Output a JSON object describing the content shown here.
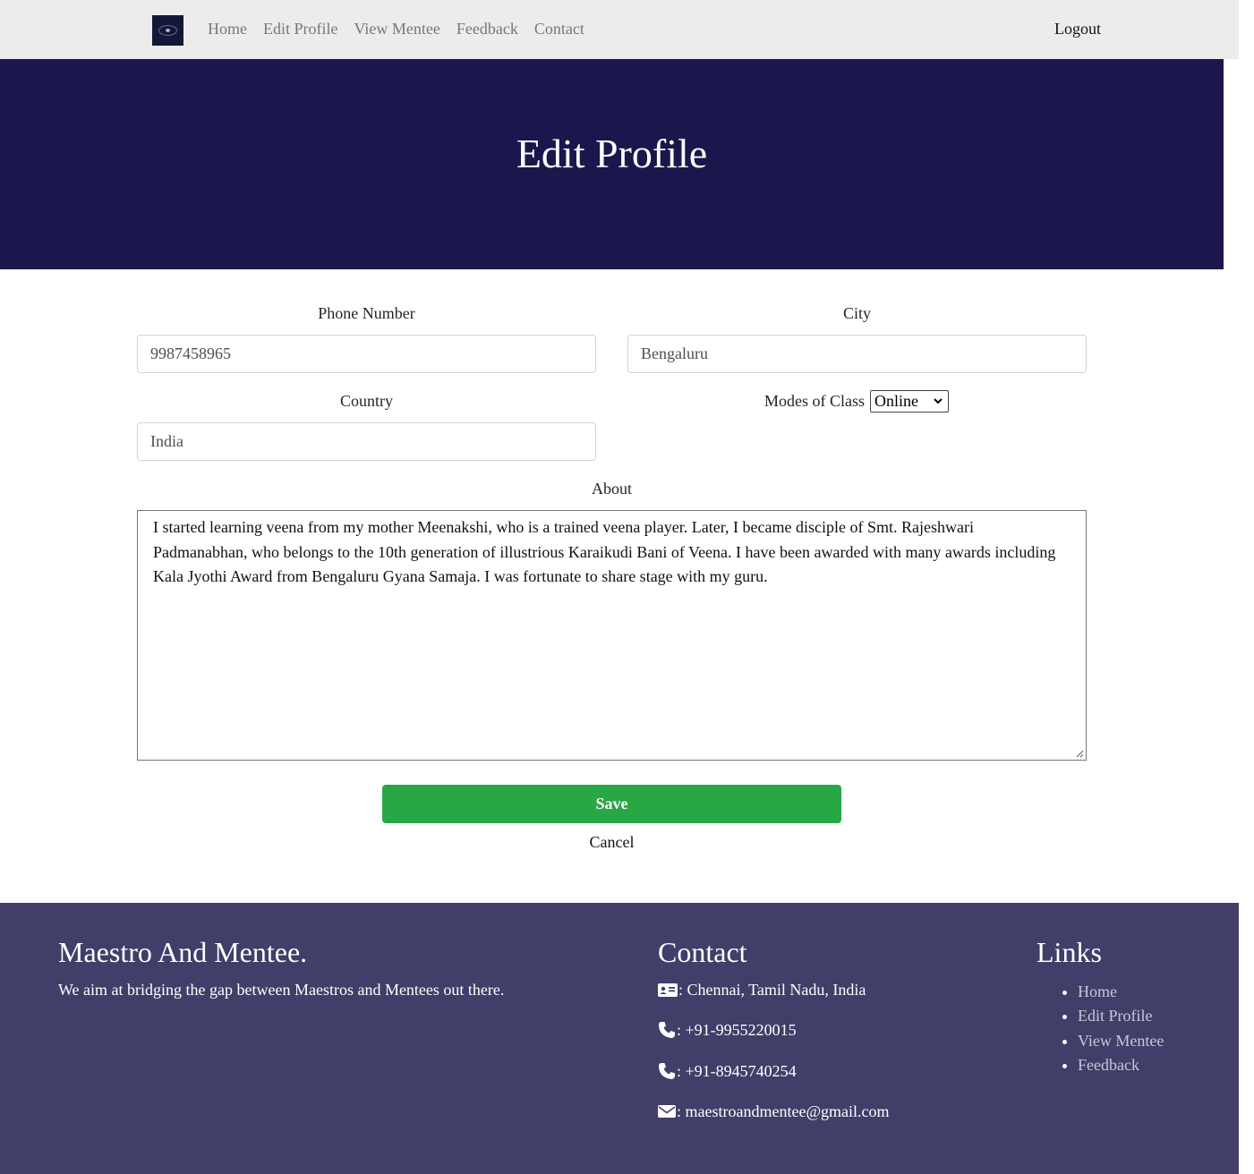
{
  "navbar": {
    "logo": "logo",
    "links": [
      "Home",
      "Edit Profile",
      "View Mentee",
      "Feedback",
      "Contact"
    ],
    "logout": "Logout"
  },
  "hero": {
    "title": "Edit Profile"
  },
  "form": {
    "phone": {
      "label": "Phone Number",
      "value": "9987458965"
    },
    "city": {
      "label": "City",
      "value": "Bengaluru"
    },
    "country": {
      "label": "Country",
      "value": "India"
    },
    "modes": {
      "label": "Modes of Class",
      "selected": "Online"
    },
    "about": {
      "label": "About",
      "value": "I started learning veena from my mother Meenakshi, who is a trained veena player. Later, I became disciple of Smt. Rajeshwari Padmanabhan, who belongs to the 10th generation of illustrious Karaikudi Bani of Veena. I have been awarded with many awards including Kala Jyothi Award from Bengaluru Gyana Samaja. I was fortunate to share stage with my guru."
    },
    "save_label": "Save",
    "cancel_label": "Cancel"
  },
  "footer": {
    "brand_title": "Maestro And Mentee.",
    "brand_text": "We aim at bridging the gap between Maestros and Mentees out there.",
    "contact_title": "Contact",
    "contact": {
      "address": ": Chennai, Tamil Nadu, India",
      "phone1": ": +91-9955220015",
      "phone2": ": +91-8945740254",
      "email": ": maestroandmentee@gmail.com"
    },
    "links_title": "Links",
    "links": [
      "Home",
      "Edit Profile",
      "View Mentee",
      "Feedback"
    ]
  },
  "colors": {
    "navbar_bg": "#ececec",
    "hero_bg": "#1b174c",
    "footer_bg": "#413e69",
    "save_button": "#28a745"
  },
  "icons": [
    "address-card-icon",
    "phone-icon",
    "envelope-icon",
    "chevron-down-icon"
  ]
}
